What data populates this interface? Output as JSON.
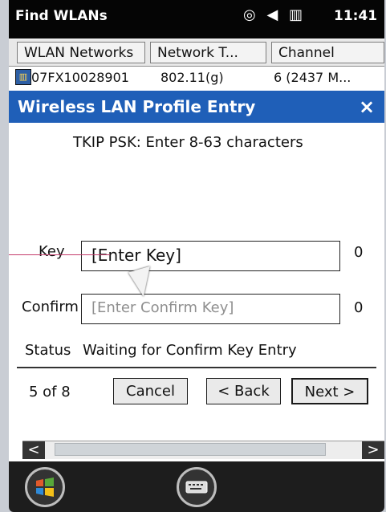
{
  "status_bar": {
    "title": "Find WLANs",
    "icons": "◎ ◀ ▥",
    "time": "11:41"
  },
  "table": {
    "columns": [
      "WLAN Networks",
      "Network T...",
      "Channel"
    ],
    "rows": [
      [
        "07FX10028901",
        "802.11(g)",
        "6 (2437 M..."
      ]
    ]
  },
  "dialog": {
    "title": "Wireless LAN Profile Entry",
    "close_label": "×",
    "hint": "TKIP PSK: Enter 8-63 characters",
    "key_label": "Key",
    "key_value": "[Enter Key]",
    "key_count": "0",
    "confirm_label": "Confirm",
    "confirm_placeholder": "[Enter Confirm Key]",
    "confirm_count": "0",
    "status_label": "Status",
    "status_value": "Waiting for Confirm Key Entry",
    "page_indicator": "5 of 8",
    "buttons": {
      "cancel": "Cancel",
      "back": "< Back",
      "next": "Next >"
    }
  },
  "scrollbar": {
    "left": "<",
    "right": ">"
  },
  "icons": {
    "start": "windows-logo-icon",
    "keyboard": "keyboard-icon"
  },
  "colors": {
    "title_bar": "#1f5fb8",
    "status_bar": "#050505"
  }
}
